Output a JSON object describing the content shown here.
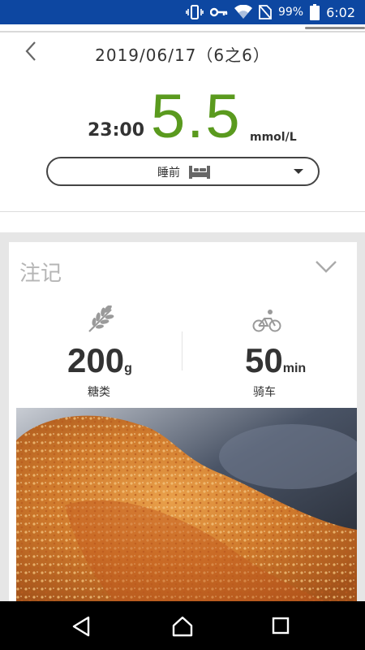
{
  "status_bar": {
    "battery": "99%",
    "time": "6:02",
    "icons": [
      "vibrate-icon",
      "key-icon",
      "wifi-icon",
      "no-sim-icon",
      "battery-icon"
    ]
  },
  "header": {
    "date_title": "2019/06/17（6之6）",
    "back_icon": "chevron-left-icon"
  },
  "reading": {
    "time": "23:00",
    "value": "5.5",
    "unit": "mmol/L",
    "value_color": "#5a9a1e"
  },
  "meal_select": {
    "selected": "睡前",
    "icon": "bed-icon"
  },
  "notes": {
    "title": "注记",
    "collapse_icon": "chevron-down-icon",
    "carbs": {
      "value": "200",
      "unit": "g",
      "label": "糖类",
      "icon": "wheat-icon"
    },
    "exercise": {
      "value": "50",
      "unit": "min",
      "label": "骑车",
      "icon": "bicycle-icon"
    },
    "photo": "fried-chicken-photo"
  },
  "nav": {
    "buttons": [
      "back-nav-icon",
      "home-nav-icon",
      "recent-apps-icon"
    ]
  },
  "colors": {
    "status_bar": "#0d47a1",
    "accent_green": "#5a9a1e"
  }
}
